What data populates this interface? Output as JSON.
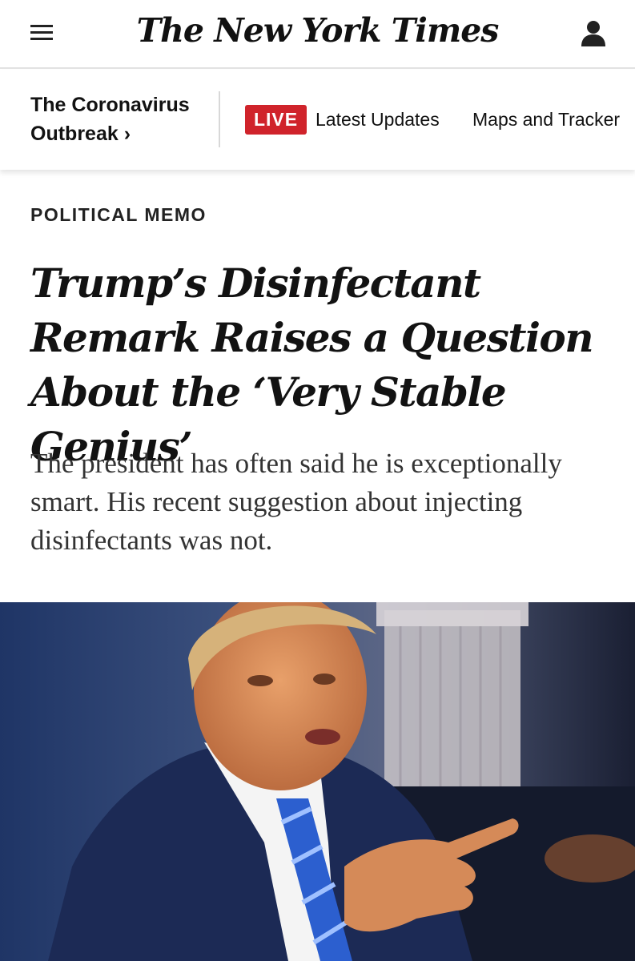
{
  "header": {
    "logo_text": "The New York Times",
    "menu_icon": "hamburger-menu-icon",
    "account_icon": "user-account-icon"
  },
  "covid_nav": {
    "section_line1": "The Coronavirus",
    "section_line2": "Outbreak",
    "chevron": "›",
    "live_badge": "LIVE",
    "latest_updates": "Latest Updates",
    "maps_tracker": "Maps and Tracker"
  },
  "article": {
    "kicker": "POLITICAL MEMO",
    "headline": "Trump’s Disinfectant Remark Raises a Question About the ‘Very Stable Genius’",
    "summary": "The president has often said he is exceptionally smart. His recent suggestion about injecting disinfectants was not."
  },
  "colors": {
    "live_red": "#d0232b",
    "text": "#121212",
    "divider": "#e2e2e2"
  }
}
